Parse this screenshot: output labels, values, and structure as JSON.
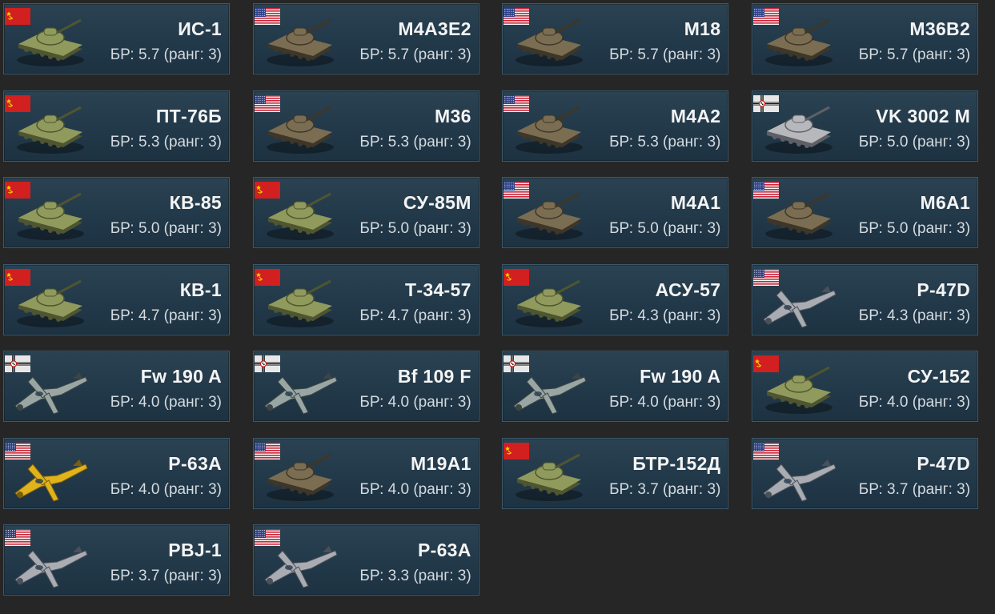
{
  "br_prefix": "БР:",
  "colors": {
    "background": "#262626",
    "card": "#22394a",
    "card_border": "#3c586b",
    "name_text": "#f4f4f4",
    "br_text": "#d4dadf"
  },
  "vehicles": [
    {
      "name": "ИС-1",
      "br": "5.7",
      "rank": "3",
      "nation": "ussr",
      "type": "tank",
      "br_text": "БР: 5.7 (ранг: 3)"
    },
    {
      "name": "M4A3E2",
      "br": "5.7",
      "rank": "3",
      "nation": "usa",
      "type": "tank",
      "br_text": "БР: 5.7 (ранг: 3)"
    },
    {
      "name": "M18",
      "br": "5.7",
      "rank": "3",
      "nation": "usa",
      "type": "tank",
      "br_text": "БР: 5.7 (ранг: 3)"
    },
    {
      "name": "M36B2",
      "br": "5.7",
      "rank": "3",
      "nation": "usa",
      "type": "tank",
      "br_text": "БР: 5.7 (ранг: 3)"
    },
    {
      "name": "ПТ-76Б",
      "br": "5.3",
      "rank": "3",
      "nation": "ussr",
      "type": "tank",
      "br_text": "БР: 5.3 (ранг: 3)"
    },
    {
      "name": "M36",
      "br": "5.3",
      "rank": "3",
      "nation": "usa",
      "type": "tank",
      "br_text": "БР: 5.3 (ранг: 3)"
    },
    {
      "name": "M4A2",
      "br": "5.3",
      "rank": "3",
      "nation": "usa",
      "type": "tank",
      "br_text": "БР: 5.3 (ранг: 3)"
    },
    {
      "name": "VK 3002 M",
      "br": "5.0",
      "rank": "3",
      "nation": "germany",
      "type": "tank",
      "br_text": "БР: 5.0 (ранг: 3)"
    },
    {
      "name": "КВ-85",
      "br": "5.0",
      "rank": "3",
      "nation": "ussr",
      "type": "tank",
      "br_text": "БР: 5.0 (ранг: 3)"
    },
    {
      "name": "СУ-85М",
      "br": "5.0",
      "rank": "3",
      "nation": "ussr",
      "type": "tank",
      "br_text": "БР: 5.0 (ранг: 3)"
    },
    {
      "name": "M4A1",
      "br": "5.0",
      "rank": "3",
      "nation": "usa",
      "type": "tank",
      "br_text": "БР: 5.0 (ранг: 3)"
    },
    {
      "name": "M6A1",
      "br": "5.0",
      "rank": "3",
      "nation": "usa",
      "type": "tank",
      "br_text": "БР: 5.0 (ранг: 3)"
    },
    {
      "name": "КВ-1",
      "br": "4.7",
      "rank": "3",
      "nation": "ussr",
      "type": "tank",
      "br_text": "БР: 4.7 (ранг: 3)"
    },
    {
      "name": "Т-34-57",
      "br": "4.7",
      "rank": "3",
      "nation": "ussr",
      "type": "tank",
      "br_text": "БР: 4.7 (ранг: 3)"
    },
    {
      "name": "АСУ-57",
      "br": "4.3",
      "rank": "3",
      "nation": "ussr",
      "type": "tank",
      "br_text": "БР: 4.3 (ранг: 3)"
    },
    {
      "name": "P-47D",
      "br": "4.3",
      "rank": "3",
      "nation": "usa",
      "type": "plane",
      "br_text": "БР: 4.3 (ранг: 3)"
    },
    {
      "name": "Fw 190 A",
      "br": "4.0",
      "rank": "3",
      "nation": "germany",
      "type": "plane",
      "br_text": "БР: 4.0 (ранг: 3)"
    },
    {
      "name": "Bf 109 F",
      "br": "4.0",
      "rank": "3",
      "nation": "germany",
      "type": "plane",
      "br_text": "БР: 4.0 (ранг: 3)"
    },
    {
      "name": "Fw 190 A",
      "br": "4.0",
      "rank": "3",
      "nation": "germany",
      "type": "plane",
      "br_text": "БР: 4.0 (ранг: 3)"
    },
    {
      "name": "СУ-152",
      "br": "4.0",
      "rank": "3",
      "nation": "ussr",
      "type": "tank",
      "br_text": "БР: 4.0 (ранг: 3)"
    },
    {
      "name": "P-63A",
      "br": "4.0",
      "rank": "3",
      "nation": "usa",
      "type": "plane",
      "br_text": "БР: 4.0 (ранг: 3)"
    },
    {
      "name": "M19A1",
      "br": "4.0",
      "rank": "3",
      "nation": "usa",
      "type": "tank",
      "br_text": "БР: 4.0 (ранг: 3)"
    },
    {
      "name": "БТР-152Д",
      "br": "3.7",
      "rank": "3",
      "nation": "ussr",
      "type": "tank",
      "br_text": "БР: 3.7 (ранг: 3)"
    },
    {
      "name": "P-47D",
      "br": "3.7",
      "rank": "3",
      "nation": "usa",
      "type": "plane",
      "br_text": "БР: 3.7 (ранг: 3)"
    },
    {
      "name": "PBJ-1",
      "br": "3.7",
      "rank": "3",
      "nation": "usa",
      "type": "plane",
      "br_text": "БР: 3.7 (ранг: 3)"
    },
    {
      "name": "P-63A",
      "br": "3.3",
      "rank": "3",
      "nation": "usa",
      "type": "plane",
      "br_text": "БР: 3.3 (ранг: 3)"
    }
  ]
}
